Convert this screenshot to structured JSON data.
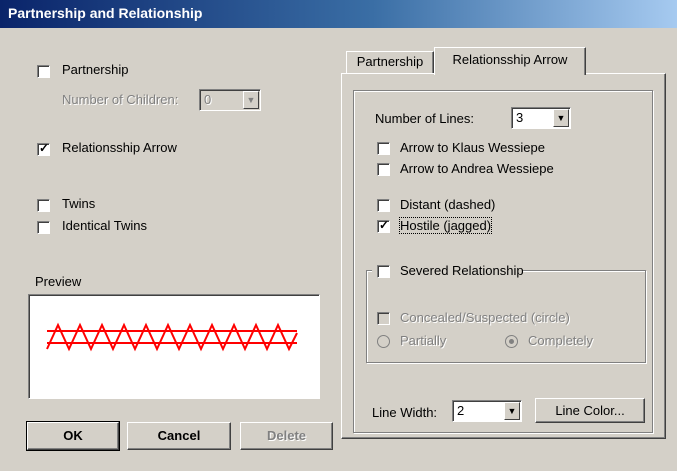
{
  "window": {
    "title": "Partnership and Relationship"
  },
  "left": {
    "partnership_label": "Partnership",
    "partnership_checked": false,
    "num_children_label": "Number of Children:",
    "num_children_value": "0",
    "relationship_arrow_label": "Relationsship Arrow",
    "relationship_arrow_checked": true,
    "twins_label": "Twins",
    "identical_twins_label": "Identical Twins",
    "preview_label": "Preview"
  },
  "buttons": {
    "ok": "OK",
    "cancel": "Cancel",
    "delete": "Delete"
  },
  "tabs": [
    {
      "label": "Partnership",
      "active": false
    },
    {
      "label": "Relationsship Arrow",
      "active": true
    }
  ],
  "arrow_tab": {
    "number_of_lines_label": "Number of Lines:",
    "number_of_lines_value": "3",
    "arrow_to_klaus": "Arrow to Klaus Wessiepe",
    "arrow_to_andrea": "Arrow to Andrea Wessiepe",
    "distant": "Distant (dashed)",
    "hostile": "Hostile (jagged)",
    "hostile_checked": true,
    "severed": "Severed Relationship",
    "concealed": "Concealed/Suspected (circle)",
    "partially": "Partially",
    "completely": "Completely",
    "line_width_label": "Line Width:",
    "line_width_value": "2",
    "line_color_button": "Line Color..."
  },
  "colors": {
    "preview_line": "#ff0000",
    "titlebar": "#0a246a"
  }
}
